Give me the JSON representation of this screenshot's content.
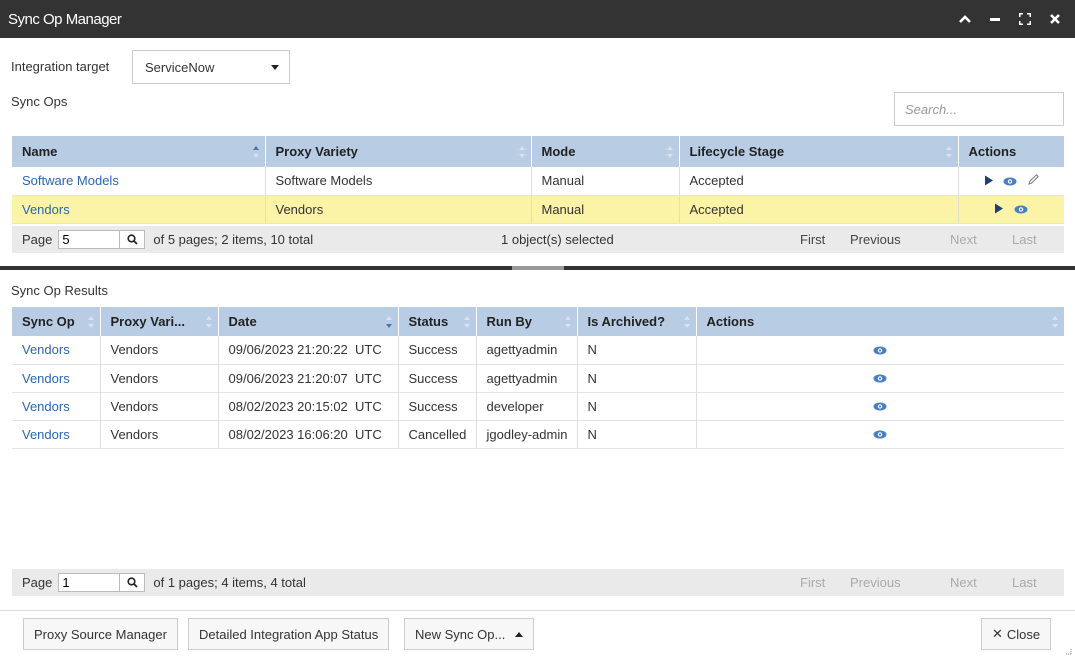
{
  "window": {
    "title": "Sync Op Manager"
  },
  "integration": {
    "label": "Integration target",
    "value": "ServiceNow"
  },
  "sync_ops": {
    "label": "Sync Ops",
    "search_placeholder": "Search...",
    "columns": [
      "Name",
      "Proxy Variety",
      "Mode",
      "Lifecycle Stage",
      "Actions"
    ],
    "rows": [
      {
        "name": "Software Models",
        "proxy": "Software Models",
        "mode": "Manual",
        "stage": "Accepted"
      },
      {
        "name": "Vendors",
        "proxy": "Vendors",
        "mode": "Manual",
        "stage": "Accepted"
      }
    ],
    "pager": {
      "page_label": "Page",
      "page_value": "5",
      "info": "of 5 pages; 2 items, 10 total",
      "selected": "1 object(s) selected",
      "first": "First",
      "previous": "Previous",
      "next": "Next",
      "last": "Last"
    }
  },
  "results": {
    "label": "Sync Op Results",
    "columns": [
      "Sync Op",
      "Proxy Vari...",
      "Date",
      "Status",
      "Run By",
      "Is Archived?",
      "Actions"
    ],
    "rows": [
      {
        "sync_op": "Vendors",
        "proxy": "Vendors",
        "date": "09/06/2023 21:20:22  UTC",
        "status": "Success",
        "run_by": "agettyadmin",
        "archived": "N"
      },
      {
        "sync_op": "Vendors",
        "proxy": "Vendors",
        "date": "09/06/2023 21:20:07  UTC",
        "status": "Success",
        "run_by": "agettyadmin",
        "archived": "N"
      },
      {
        "sync_op": "Vendors",
        "proxy": "Vendors",
        "date": "08/02/2023 20:15:02  UTC",
        "status": "Success",
        "run_by": "developer",
        "archived": "N"
      },
      {
        "sync_op": "Vendors",
        "proxy": "Vendors",
        "date": "08/02/2023 16:06:20  UTC",
        "status": "Cancelled",
        "run_by": "jgodley-admin",
        "archived": "N"
      }
    ],
    "pager": {
      "page_label": "Page",
      "page_value": "1",
      "info": "of 1 pages; 4 items, 4 total",
      "first": "First",
      "previous": "Previous",
      "next": "Next",
      "last": "Last"
    }
  },
  "footer": {
    "proxy_source": "Proxy Source Manager",
    "detailed_status": "Detailed Integration App Status",
    "new_sync_op": "New Sync Op...",
    "close": "Close",
    "close_glyph": "✕"
  },
  "colors": {
    "header_bg": "#b8cce4",
    "selected_row": "#fbf3a6",
    "link": "#2b66b1",
    "titlebar": "#333333"
  }
}
